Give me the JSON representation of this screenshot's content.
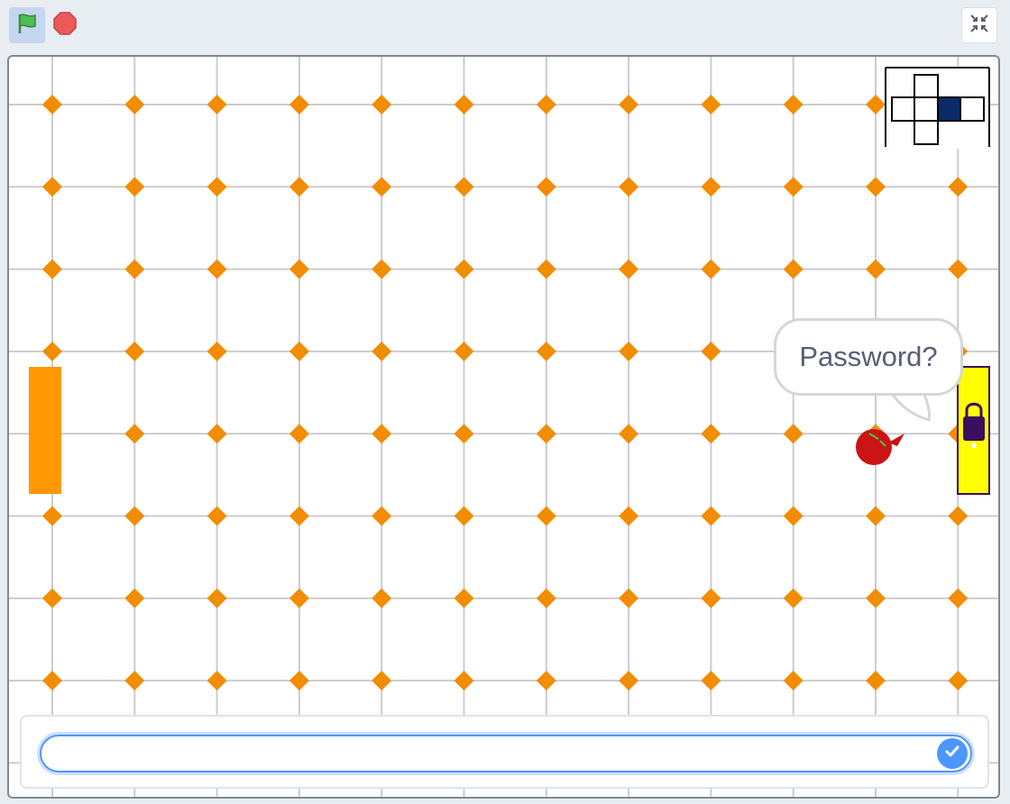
{
  "toolbar": {
    "green_flag_icon": "green-flag-icon",
    "stop_icon": "stop-sign-icon",
    "fullscreen_icon": "shrink-fullscreen-icon"
  },
  "stage": {
    "speech_text": "Password?",
    "minimap": {
      "highlighted_cell": "center-right",
      "highlight_color": "#0a2a6b"
    },
    "sprites": {
      "left_door_color": "#ff9800",
      "right_door_color": "#ffff00",
      "lock_color": "#3a0f5e",
      "player_color": "#cc1414"
    },
    "dot_color": "#f28c00",
    "grid_color": "#cccccc"
  },
  "ask": {
    "value": "",
    "confirm_icon": "check-mark-icon"
  }
}
